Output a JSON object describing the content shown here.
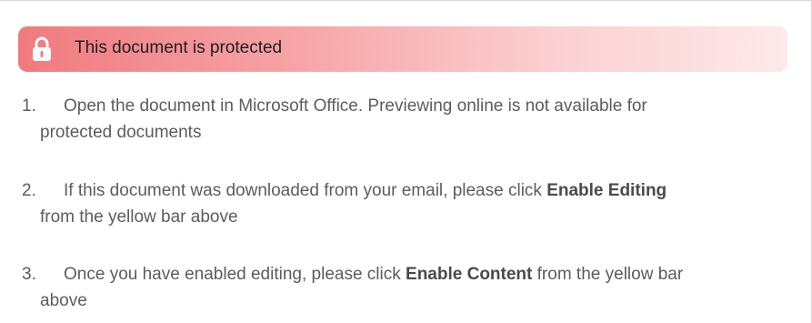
{
  "banner": {
    "title": "This document is protected",
    "icon": "lock-icon",
    "accent": "#f07a7e"
  },
  "steps": [
    {
      "number": "1.",
      "line1": "Open the document in Microsoft Office. Previewing online is not available for",
      "line2": "protected documents"
    },
    {
      "number": "2.",
      "line1_pre": "If this document was downloaded from your email, please click ",
      "line1_bold": "Enable Editing",
      "line2": "from the yellow bar above"
    },
    {
      "number": "3.",
      "line1_pre": "Once you have enabled editing, please click ",
      "line1_bold": "Enable Content",
      "line1_post": " from the yellow bar",
      "line2": "above"
    }
  ]
}
